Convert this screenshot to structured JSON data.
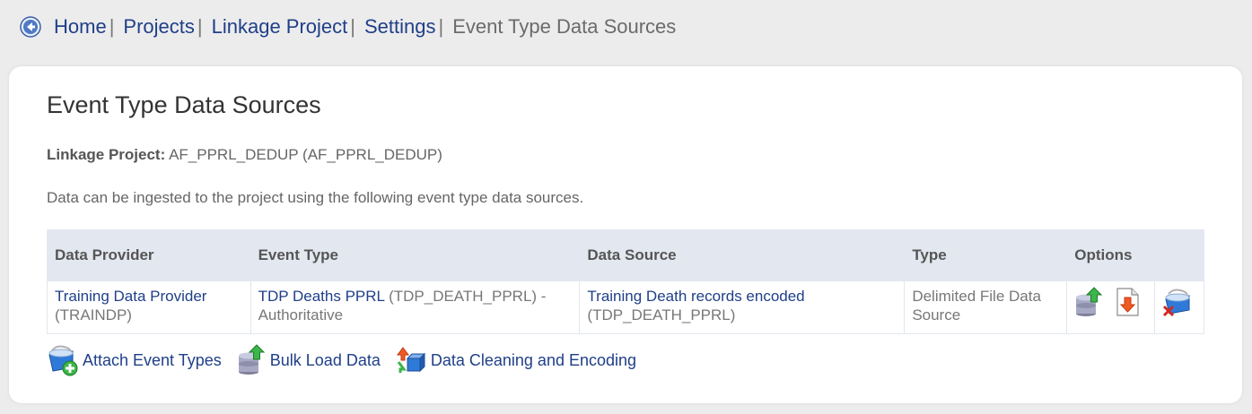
{
  "breadcrumb": {
    "items": [
      "Home",
      "Projects",
      "Linkage Project",
      "Settings"
    ],
    "separator": "|",
    "current": "Event Type Data Sources"
  },
  "page": {
    "title": "Event Type Data Sources",
    "project_label": "Linkage Project:",
    "project_value": "AF_PPRL_DEDUP (AF_PPRL_DEDUP)",
    "description": "Data can be ingested to the project using the following event type data sources."
  },
  "table": {
    "headers": [
      "Data Provider",
      "Event Type",
      "Data Source",
      "Type",
      "Options"
    ],
    "rows": [
      {
        "provider_name": "Training Data Provider",
        "provider_code": "(TRAINDP)",
        "event_type_name": "TDP Deaths PPRL",
        "event_type_code": "(TDP_DEATH_PPRL) -",
        "event_type_note": "Authoritative",
        "source_name": "Training Death records encoded",
        "source_code": "(TDP_DEATH_PPRL)",
        "type_line1": "Delimited File Data",
        "type_line2": "Source",
        "options": [
          "database-upload-icon",
          "download-file-icon",
          "delete-source-icon"
        ]
      }
    ]
  },
  "actions": [
    {
      "label": "Attach Event Types",
      "icon": "attach-event-types-icon"
    },
    {
      "label": "Bulk Load Data",
      "icon": "bulk-load-icon"
    },
    {
      "label": "Data Cleaning and Encoding",
      "icon": "cleaning-encoding-icon"
    }
  ],
  "colors": {
    "link": "#1f3f88",
    "header_bg": "#e3e8f0",
    "page_bg": "#ececec"
  }
}
